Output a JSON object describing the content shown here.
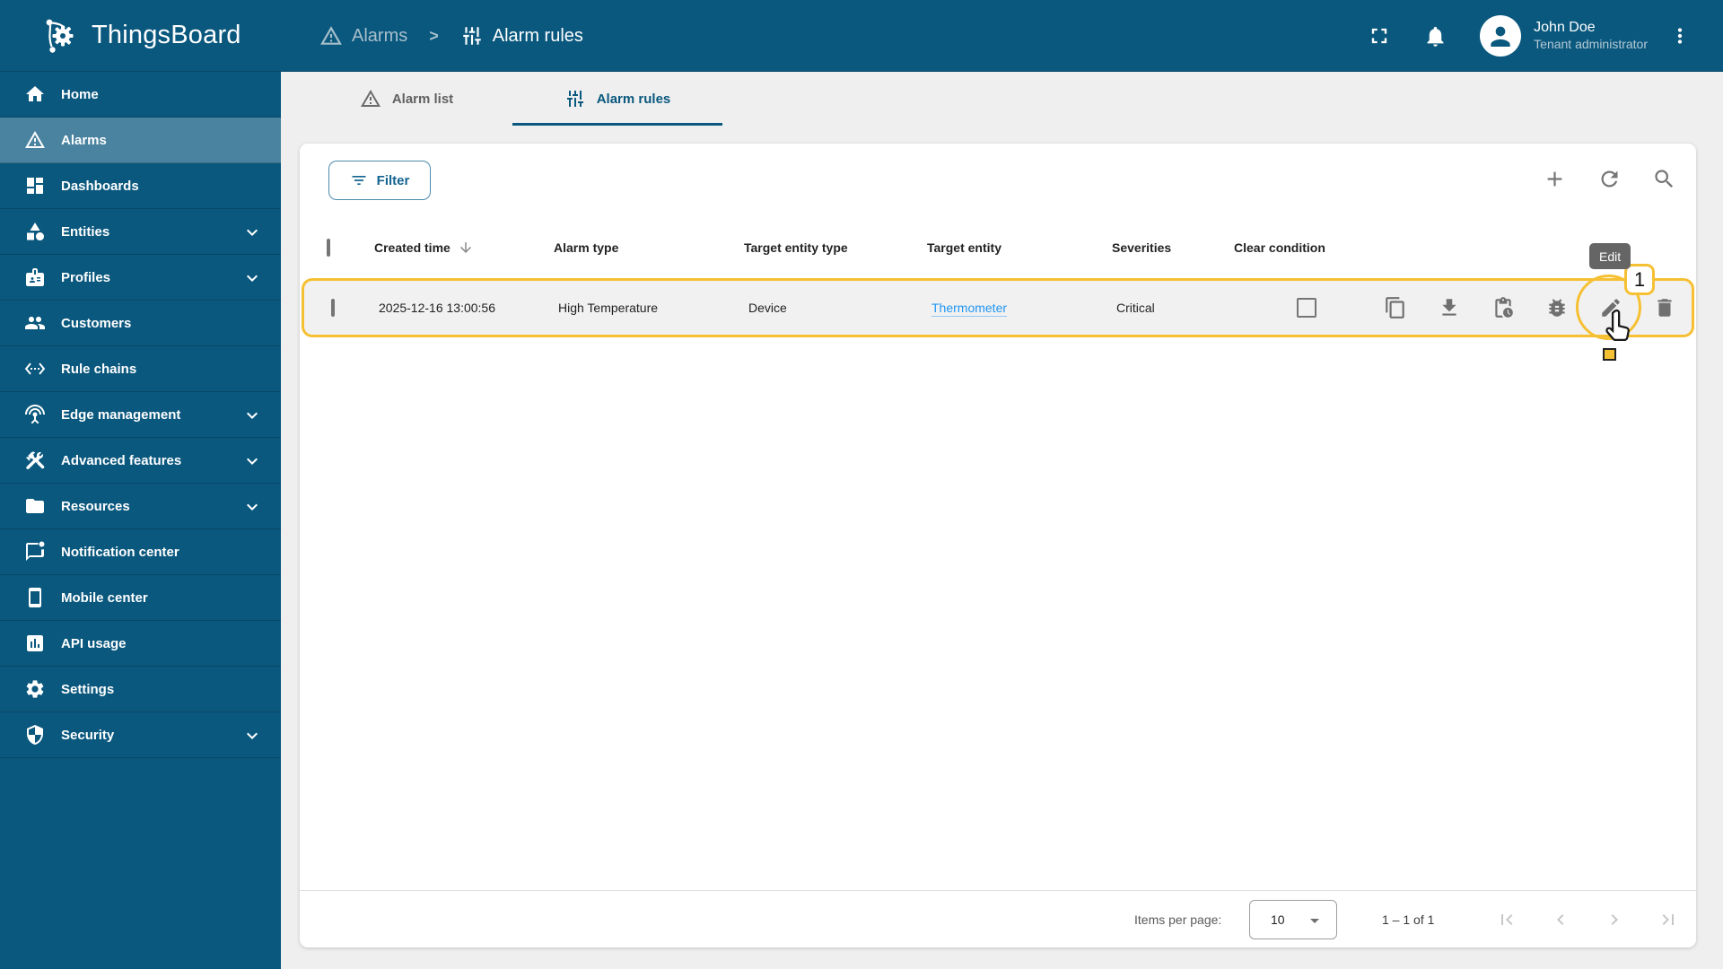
{
  "app": {
    "title": "ThingsBoard"
  },
  "header": {
    "breadcrumb": [
      {
        "icon": "warning-icon",
        "label": "Alarms"
      },
      {
        "icon": "alarm-rules-icon",
        "label": "Alarm rules"
      }
    ],
    "separator": ">",
    "user": {
      "name": "John Doe",
      "role": "Tenant administrator"
    },
    "icons": [
      "fullscreen-icon",
      "notifications-bell-icon",
      "avatar",
      "kebab-menu-icon"
    ]
  },
  "sidebar": {
    "items": [
      {
        "label": "Home",
        "icon": "home",
        "selected": false,
        "expandable": false
      },
      {
        "label": "Alarms",
        "icon": "warning",
        "selected": true,
        "expandable": false
      },
      {
        "label": "Dashboards",
        "icon": "dashboard",
        "selected": false,
        "expandable": false
      },
      {
        "label": "Entities",
        "icon": "category",
        "selected": false,
        "expandable": true
      },
      {
        "label": "Profiles",
        "icon": "badge",
        "selected": false,
        "expandable": true
      },
      {
        "label": "Customers",
        "icon": "people",
        "selected": false,
        "expandable": false
      },
      {
        "label": "Rule chains",
        "icon": "ethernet",
        "selected": false,
        "expandable": false
      },
      {
        "label": "Edge management",
        "icon": "antenna",
        "selected": false,
        "expandable": true
      },
      {
        "label": "Advanced features",
        "icon": "construction",
        "selected": false,
        "expandable": true
      },
      {
        "label": "Resources",
        "icon": "folder",
        "selected": false,
        "expandable": true
      },
      {
        "label": "Notification center",
        "icon": "notification",
        "selected": false,
        "expandable": false
      },
      {
        "label": "Mobile center",
        "icon": "mobile",
        "selected": false,
        "expandable": false
      },
      {
        "label": "API usage",
        "icon": "chart",
        "selected": false,
        "expandable": false
      },
      {
        "label": "Settings",
        "icon": "gear",
        "selected": false,
        "expandable": false
      },
      {
        "label": "Security",
        "icon": "shield",
        "selected": false,
        "expandable": true
      }
    ]
  },
  "tabs": [
    {
      "label": "Alarm list",
      "icon": "warning-icon",
      "active": false
    },
    {
      "label": "Alarm rules",
      "icon": "alarm-rules-icon",
      "active": true
    }
  ],
  "toolbar": {
    "filter_label": "Filter",
    "icons": [
      "add-icon",
      "refresh-icon",
      "search-icon"
    ]
  },
  "table": {
    "columns": [
      "Created time",
      "Alarm type",
      "Target entity type",
      "Target entity",
      "Severities",
      "Clear condition"
    ],
    "sorted_by": "Created time",
    "sort_direction": "desc",
    "rows": [
      {
        "created_time": "2025-12-16 13:00:56",
        "alarm_type": "High Temperature",
        "target_entity_type": "Device",
        "target_entity": "Thermometer",
        "severities": "Critical",
        "clear_condition_checked": false
      }
    ],
    "row_actions": [
      {
        "name": "copy",
        "icon": "copy-icon"
      },
      {
        "name": "export",
        "icon": "download-icon"
      },
      {
        "name": "test",
        "icon": "pending-actions-icon"
      },
      {
        "name": "debug",
        "icon": "bug-icon"
      },
      {
        "name": "edit",
        "icon": "edit-icon"
      },
      {
        "name": "delete",
        "icon": "delete-icon"
      }
    ]
  },
  "tour": {
    "tooltip_label": "Edit",
    "step": "1"
  },
  "pagination": {
    "items_per_page_label": "Items per page:",
    "page_size": "10",
    "range": "1 – 1 of 1",
    "nav": [
      "first-page-icon",
      "chevron-left-icon",
      "chevron-right-icon",
      "last-page-icon"
    ]
  },
  "colors": {
    "primary": "#0A587E",
    "highlight": "#F6C033",
    "link": "#2196f3"
  }
}
